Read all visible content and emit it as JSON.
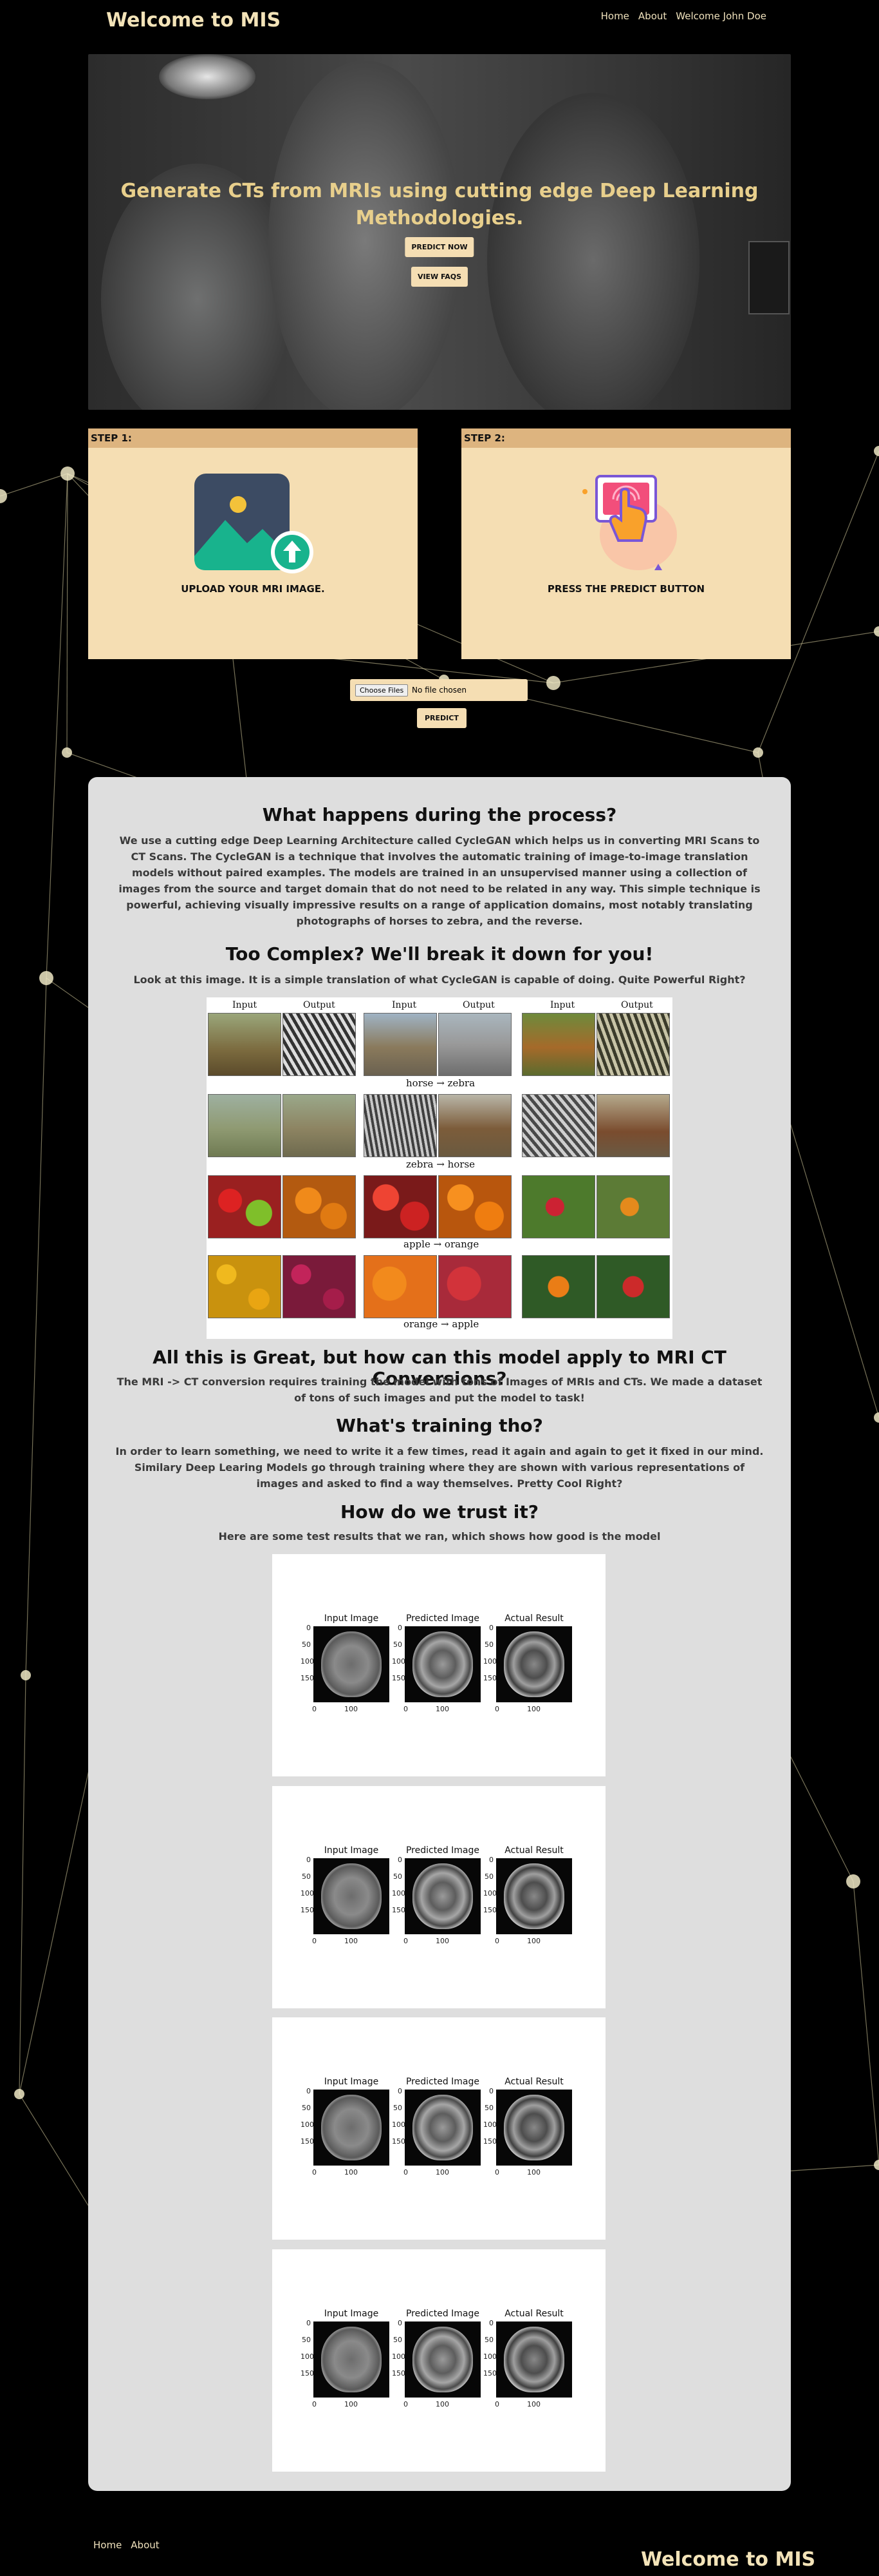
{
  "header": {
    "brand": "Welcome to MIS",
    "nav": [
      "Home",
      "About",
      "Welcome John Doe"
    ]
  },
  "hero": {
    "title_line1": "Generate CTs from MRIs using cutting edge Deep Learning",
    "title_line2": "Methodologies.",
    "predict_now": "PREDICT NOW",
    "view_faqs": "VIEW FAQS"
  },
  "steps": [
    {
      "label": "STEP 1:",
      "caption": "UPLOAD YOUR MRI IMAGE.",
      "icon": "image-upload-icon"
    },
    {
      "label": "STEP 2:",
      "caption": "PRESS THE PREDICT BUTTON",
      "icon": "tap-button-icon"
    }
  ],
  "upload": {
    "choose": "Choose Files",
    "status": "No file chosen",
    "predict": "PREDICT"
  },
  "sections": {
    "process_title": "What happens during the process?",
    "process_text": "We use a cutting edge Deep Learning Architecture called CycleGAN which helps us in converting MRI Scans to CT Scans. The CycleGAN is a technique that involves the automatic training of image-to-image translation models without paired examples. The models are trained in an unsupervised manner using a collection of images from the source and target domain that do not need to be related in any way. This simple technique is powerful, achieving visually impressive results on a range of application domains, most notably translating photographs of horses to zebra, and the reverse.",
    "complex_title": "Too Complex? We'll break it down for you!",
    "complex_text": "Look at this image. It is a simple translation of what CycleGAN is capable of doing. Quite Powerful Right?",
    "apply_title": "All this is Great, but how can this model apply to MRI CT Conversions?",
    "apply_text": "The MRI -> CT conversion requires training the model with tons of Images of MRIs and CTs. We made a dataset of tons of such images and put the model to task!",
    "training_title": "What's training tho?",
    "training_text": "In order to learn something, we need to write it a few times, read it again and again to get it fixed in our mind. Similary Deep Learing Models go through training where they are shown with various representations of images and asked to find a way themselves. Pretty Cool Right?",
    "trust_title": "How do we trust it?",
    "trust_text": "Here are some test results that we ran, which shows how good is the model"
  },
  "cycle_figure": {
    "col_input": "Input",
    "col_output": "Output",
    "captions": [
      "horse → zebra",
      "zebra → horse",
      "apple → orange",
      "orange → apple"
    ]
  },
  "results": {
    "titles": [
      "Input Image",
      "Predicted Image",
      "Actual Result"
    ],
    "yticks": [
      "0",
      "50",
      "100",
      "150"
    ],
    "xticks": [
      "0",
      "100"
    ]
  },
  "footer": {
    "nav": [
      "Home",
      "About"
    ],
    "brand": "Welcome to MIS"
  },
  "colors": {
    "accent": "#f5deb3",
    "step_header": "#ddb47f",
    "panel": "#dedede",
    "brand_text": "#f3e3b8"
  }
}
